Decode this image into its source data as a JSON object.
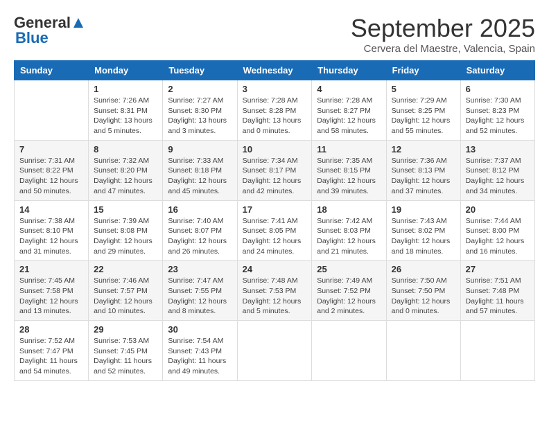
{
  "logo": {
    "general": "General",
    "blue": "Blue"
  },
  "header": {
    "title": "September 2025",
    "location": "Cervera del Maestre, Valencia, Spain"
  },
  "days_of_week": [
    "Sunday",
    "Monday",
    "Tuesday",
    "Wednesday",
    "Thursday",
    "Friday",
    "Saturday"
  ],
  "weeks": [
    [
      {
        "day": "",
        "info": ""
      },
      {
        "day": "1",
        "info": "Sunrise: 7:26 AM\nSunset: 8:31 PM\nDaylight: 13 hours\nand 5 minutes."
      },
      {
        "day": "2",
        "info": "Sunrise: 7:27 AM\nSunset: 8:30 PM\nDaylight: 13 hours\nand 3 minutes."
      },
      {
        "day": "3",
        "info": "Sunrise: 7:28 AM\nSunset: 8:28 PM\nDaylight: 13 hours\nand 0 minutes."
      },
      {
        "day": "4",
        "info": "Sunrise: 7:28 AM\nSunset: 8:27 PM\nDaylight: 12 hours\nand 58 minutes."
      },
      {
        "day": "5",
        "info": "Sunrise: 7:29 AM\nSunset: 8:25 PM\nDaylight: 12 hours\nand 55 minutes."
      },
      {
        "day": "6",
        "info": "Sunrise: 7:30 AM\nSunset: 8:23 PM\nDaylight: 12 hours\nand 52 minutes."
      }
    ],
    [
      {
        "day": "7",
        "info": "Sunrise: 7:31 AM\nSunset: 8:22 PM\nDaylight: 12 hours\nand 50 minutes."
      },
      {
        "day": "8",
        "info": "Sunrise: 7:32 AM\nSunset: 8:20 PM\nDaylight: 12 hours\nand 47 minutes."
      },
      {
        "day": "9",
        "info": "Sunrise: 7:33 AM\nSunset: 8:18 PM\nDaylight: 12 hours\nand 45 minutes."
      },
      {
        "day": "10",
        "info": "Sunrise: 7:34 AM\nSunset: 8:17 PM\nDaylight: 12 hours\nand 42 minutes."
      },
      {
        "day": "11",
        "info": "Sunrise: 7:35 AM\nSunset: 8:15 PM\nDaylight: 12 hours\nand 39 minutes."
      },
      {
        "day": "12",
        "info": "Sunrise: 7:36 AM\nSunset: 8:13 PM\nDaylight: 12 hours\nand 37 minutes."
      },
      {
        "day": "13",
        "info": "Sunrise: 7:37 AM\nSunset: 8:12 PM\nDaylight: 12 hours\nand 34 minutes."
      }
    ],
    [
      {
        "day": "14",
        "info": "Sunrise: 7:38 AM\nSunset: 8:10 PM\nDaylight: 12 hours\nand 31 minutes."
      },
      {
        "day": "15",
        "info": "Sunrise: 7:39 AM\nSunset: 8:08 PM\nDaylight: 12 hours\nand 29 minutes."
      },
      {
        "day": "16",
        "info": "Sunrise: 7:40 AM\nSunset: 8:07 PM\nDaylight: 12 hours\nand 26 minutes."
      },
      {
        "day": "17",
        "info": "Sunrise: 7:41 AM\nSunset: 8:05 PM\nDaylight: 12 hours\nand 24 minutes."
      },
      {
        "day": "18",
        "info": "Sunrise: 7:42 AM\nSunset: 8:03 PM\nDaylight: 12 hours\nand 21 minutes."
      },
      {
        "day": "19",
        "info": "Sunrise: 7:43 AM\nSunset: 8:02 PM\nDaylight: 12 hours\nand 18 minutes."
      },
      {
        "day": "20",
        "info": "Sunrise: 7:44 AM\nSunset: 8:00 PM\nDaylight: 12 hours\nand 16 minutes."
      }
    ],
    [
      {
        "day": "21",
        "info": "Sunrise: 7:45 AM\nSunset: 7:58 PM\nDaylight: 12 hours\nand 13 minutes."
      },
      {
        "day": "22",
        "info": "Sunrise: 7:46 AM\nSunset: 7:57 PM\nDaylight: 12 hours\nand 10 minutes."
      },
      {
        "day": "23",
        "info": "Sunrise: 7:47 AM\nSunset: 7:55 PM\nDaylight: 12 hours\nand 8 minutes."
      },
      {
        "day": "24",
        "info": "Sunrise: 7:48 AM\nSunset: 7:53 PM\nDaylight: 12 hours\nand 5 minutes."
      },
      {
        "day": "25",
        "info": "Sunrise: 7:49 AM\nSunset: 7:52 PM\nDaylight: 12 hours\nand 2 minutes."
      },
      {
        "day": "26",
        "info": "Sunrise: 7:50 AM\nSunset: 7:50 PM\nDaylight: 12 hours\nand 0 minutes."
      },
      {
        "day": "27",
        "info": "Sunrise: 7:51 AM\nSunset: 7:48 PM\nDaylight: 11 hours\nand 57 minutes."
      }
    ],
    [
      {
        "day": "28",
        "info": "Sunrise: 7:52 AM\nSunset: 7:47 PM\nDaylight: 11 hours\nand 54 minutes."
      },
      {
        "day": "29",
        "info": "Sunrise: 7:53 AM\nSunset: 7:45 PM\nDaylight: 11 hours\nand 52 minutes."
      },
      {
        "day": "30",
        "info": "Sunrise: 7:54 AM\nSunset: 7:43 PM\nDaylight: 11 hours\nand 49 minutes."
      },
      {
        "day": "",
        "info": ""
      },
      {
        "day": "",
        "info": ""
      },
      {
        "day": "",
        "info": ""
      },
      {
        "day": "",
        "info": ""
      }
    ]
  ]
}
